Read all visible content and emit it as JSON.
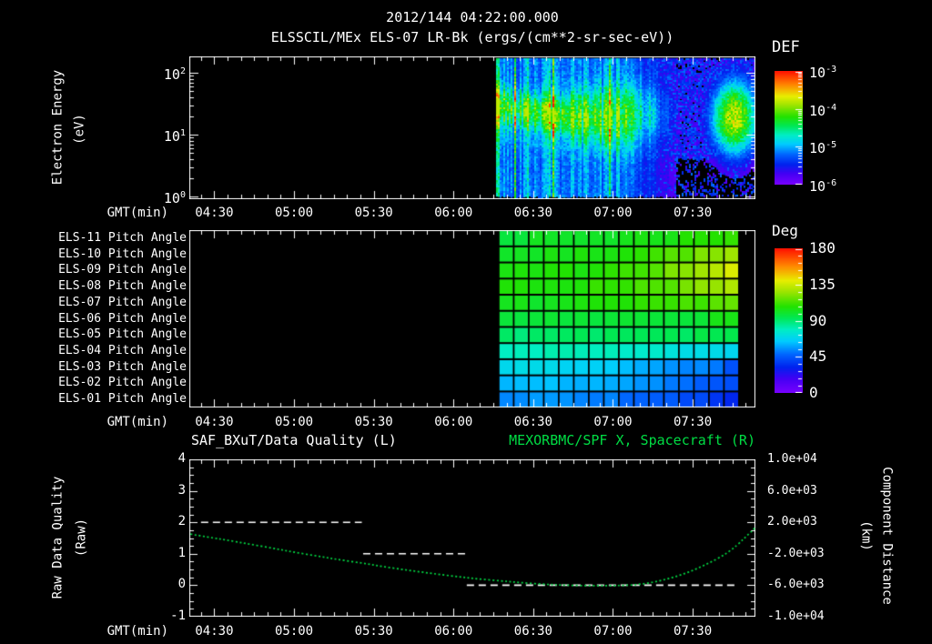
{
  "header": {
    "datetime": "2012/144 04:22:00.000",
    "title": "ELSSCIL/MEx ELS-07 LR-Bk  (ergs/(cm**2-sr-sec-eV))"
  },
  "colors": {
    "background": "#000000",
    "foreground": "#ffffff",
    "accent_green": "#00dd44",
    "colormap_stops": [
      [
        0.0,
        "#7a00ff"
      ],
      [
        0.1,
        "#4400f4"
      ],
      [
        0.18,
        "#0022ee"
      ],
      [
        0.27,
        "#0066ff"
      ],
      [
        0.36,
        "#00ccff"
      ],
      [
        0.44,
        "#00eec4"
      ],
      [
        0.52,
        "#00e855"
      ],
      [
        0.6,
        "#22e200"
      ],
      [
        0.7,
        "#9ae400"
      ],
      [
        0.78,
        "#e8ee00"
      ],
      [
        0.88,
        "#ff8800"
      ],
      [
        1.0,
        "#ff1100"
      ]
    ]
  },
  "time_axis": {
    "label": "GMT(min)",
    "start_minutes": 260.6,
    "end_minutes": 473.6,
    "minor_tick_minutes": 5,
    "major_ticks": [
      {
        "minutes": 270,
        "label": "04:30"
      },
      {
        "minutes": 300,
        "label": "05:00"
      },
      {
        "minutes": 330,
        "label": "05:30"
      },
      {
        "minutes": 360,
        "label": "06:00"
      },
      {
        "minutes": 390,
        "label": "06:30"
      },
      {
        "minutes": 420,
        "label": "07:00"
      },
      {
        "minutes": 450,
        "label": "07:30"
      }
    ]
  },
  "chart_data": [
    {
      "id": "electron_energy_spectrogram",
      "type": "heatmap",
      "ylabel": "Electron Energy",
      "yunits": "(eV)",
      "yscale": "log",
      "ylim_ev": [
        1,
        200
      ],
      "ytick_labels": [
        {
          "base": "10",
          "exp": "2"
        },
        {
          "base": "10",
          "exp": "1"
        },
        {
          "base": "10",
          "exp": "0"
        }
      ],
      "colorbar": {
        "label": "DEF",
        "units": "ergs/(cm**2-sr-sec-eV)",
        "tick_labels": [
          {
            "base": "10",
            "exp": "-3"
          },
          {
            "base": "10",
            "exp": "-4"
          },
          {
            "base": "10",
            "exp": "-5"
          },
          {
            "base": "10",
            "exp": "-6"
          }
        ]
      },
      "data_start_minutes": 376,
      "data_end_minutes": 473.6,
      "features": {
        "main_band": "bright green flux band ~1e-4 between 4-40 eV from 06:17 to ~06:55 with vertical streaks",
        "lower_band": "cyan-blue layer ~1e-5 just below main band until ~06:50",
        "right_blob": "intense green blob with yellow core 07:38-07:53 spanning ~3-60 eV",
        "background": "scattered violet/blue 1e-6..1e-5 noise, mostly black below 2 eV after 06:50"
      }
    },
    {
      "id": "pitch_angle_panel",
      "type": "heatmap",
      "colorbar": {
        "label": "Deg",
        "ticks": [
          "180",
          "135",
          "90",
          "45",
          "0"
        ]
      },
      "data_start_minutes": 377,
      "data_end_minutes": 467.4,
      "columns": 16,
      "rows": [
        {
          "label": "ELS-11 Pitch Angle",
          "start_deg": 100,
          "end_deg": 112
        },
        {
          "label": "ELS-10 Pitch Angle",
          "start_deg": 102,
          "end_deg": 128
        },
        {
          "label": "ELS-09 Pitch Angle",
          "start_deg": 104,
          "end_deg": 138
        },
        {
          "label": "ELS-08 Pitch Angle",
          "start_deg": 106,
          "end_deg": 130
        },
        {
          "label": "ELS-07 Pitch Angle",
          "start_deg": 102,
          "end_deg": 120
        },
        {
          "label": "ELS-06 Pitch Angle",
          "start_deg": 97,
          "end_deg": 103
        },
        {
          "label": "ELS-05 Pitch Angle",
          "start_deg": 91,
          "end_deg": 95
        },
        {
          "label": "ELS-04 Pitch Angle",
          "start_deg": 81,
          "end_deg": 66
        },
        {
          "label": "ELS-03 Pitch Angle",
          "start_deg": 71,
          "end_deg": 44
        },
        {
          "label": "ELS-02 Pitch Angle",
          "start_deg": 63,
          "end_deg": 40
        },
        {
          "label": "ELS-01 Pitch Angle",
          "start_deg": 56,
          "end_deg": 32
        }
      ]
    },
    {
      "id": "quality_and_spacecraft_x",
      "type": "line",
      "title_left": "SAF_BXuT/Data Quality (L)",
      "title_right": "MEXORBMC/SPF X, Spacecraft (R)",
      "ylabel_left": "Raw Data Quality",
      "yunits_left": "(Raw)",
      "ylim_left": [
        -1,
        4
      ],
      "yticks_left": [
        "4",
        "3",
        "2",
        "1",
        "0",
        "-1"
      ],
      "minor_step_left": 0.25,
      "ylabel_right": "Component Distance",
      "yunits_right": "(km)",
      "ylim_right": [
        -10000,
        10000
      ],
      "yticks_right": [
        "1.0e+04",
        "6.0e+03",
        "2.0e+03",
        "-2.0e+03",
        "-6.0e+03",
        "-1.0e+04"
      ],
      "ytick_values_right": [
        10000,
        6000,
        2000,
        -2000,
        -6000,
        -10000
      ],
      "minor_step_km": 1000,
      "quality_segments": [
        {
          "value": 2,
          "start_minutes": 265,
          "end_minutes": 325.5
        },
        {
          "value": 1,
          "start_minutes": 326,
          "end_minutes": 365
        },
        {
          "value": 0,
          "start_minutes": 365,
          "end_minutes": 467
        }
      ],
      "spacecraft_x_series": [
        [
          261,
          500
        ],
        [
          268,
          100
        ],
        [
          275,
          -280
        ],
        [
          283,
          -760
        ],
        [
          292,
          -1290
        ],
        [
          300,
          -1800
        ],
        [
          309,
          -2300
        ],
        [
          317,
          -2760
        ],
        [
          326,
          -3200
        ],
        [
          334,
          -3660
        ],
        [
          343,
          -4100
        ],
        [
          352,
          -4510
        ],
        [
          361,
          -4890
        ],
        [
          369,
          -5190
        ],
        [
          378,
          -5450
        ],
        [
          386,
          -5690
        ],
        [
          395,
          -5900
        ],
        [
          403,
          -6010
        ],
        [
          412,
          -6070
        ],
        [
          419,
          -6060
        ],
        [
          426,
          -6010
        ],
        [
          431,
          -5850
        ],
        [
          436,
          -5560
        ],
        [
          441,
          -5150
        ],
        [
          446,
          -4660
        ],
        [
          451,
          -3980
        ],
        [
          456,
          -3200
        ],
        [
          461,
          -2330
        ],
        [
          465,
          -1400
        ],
        [
          468,
          -500
        ],
        [
          470,
          170
        ],
        [
          472,
          800
        ],
        [
          473.5,
          1330
        ]
      ]
    }
  ]
}
